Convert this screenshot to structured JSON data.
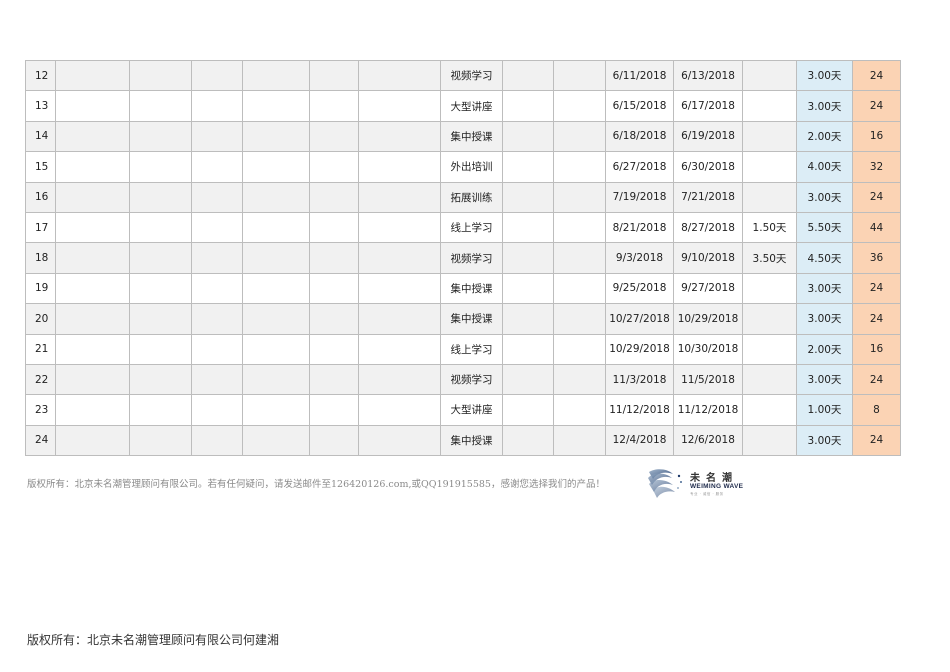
{
  "table": {
    "rows": [
      {
        "no": "12",
        "type": "视频学习",
        "start": "6/11/2018",
        "end": "6/13/2018",
        "extra": "",
        "days": "3.00天",
        "hours": "24"
      },
      {
        "no": "13",
        "type": "大型讲座",
        "start": "6/15/2018",
        "end": "6/17/2018",
        "extra": "",
        "days": "3.00天",
        "hours": "24"
      },
      {
        "no": "14",
        "type": "集中授课",
        "start": "6/18/2018",
        "end": "6/19/2018",
        "extra": "",
        "days": "2.00天",
        "hours": "16"
      },
      {
        "no": "15",
        "type": "外出培训",
        "start": "6/27/2018",
        "end": "6/30/2018",
        "extra": "",
        "days": "4.00天",
        "hours": "32"
      },
      {
        "no": "16",
        "type": "拓展训练",
        "start": "7/19/2018",
        "end": "7/21/2018",
        "extra": "",
        "days": "3.00天",
        "hours": "24"
      },
      {
        "no": "17",
        "type": "线上学习",
        "start": "8/21/2018",
        "end": "8/27/2018",
        "extra": "1.50天",
        "days": "5.50天",
        "hours": "44"
      },
      {
        "no": "18",
        "type": "视频学习",
        "start": "9/3/2018",
        "end": "9/10/2018",
        "extra": "3.50天",
        "days": "4.50天",
        "hours": "36"
      },
      {
        "no": "19",
        "type": "集中授课",
        "start": "9/25/2018",
        "end": "9/27/2018",
        "extra": "",
        "days": "3.00天",
        "hours": "24"
      },
      {
        "no": "20",
        "type": "集中授课",
        "start": "10/27/2018",
        "end": "10/29/2018",
        "extra": "",
        "days": "3.00天",
        "hours": "24"
      },
      {
        "no": "21",
        "type": "线上学习",
        "start": "10/29/2018",
        "end": "10/30/2018",
        "extra": "",
        "days": "2.00天",
        "hours": "16"
      },
      {
        "no": "22",
        "type": "视频学习",
        "start": "11/3/2018",
        "end": "11/5/2018",
        "extra": "",
        "days": "3.00天",
        "hours": "24"
      },
      {
        "no": "23",
        "type": "大型讲座",
        "start": "11/12/2018",
        "end": "11/12/2018",
        "extra": "",
        "days": "1.00天",
        "hours": "8"
      },
      {
        "no": "24",
        "type": "集中授课",
        "start": "12/4/2018",
        "end": "12/6/2018",
        "extra": "",
        "days": "3.00天",
        "hours": "24"
      }
    ]
  },
  "footnote": "版权所有：北京未名潮管理顾问有限公司。若有任何疑问，请发送邮件至126420126.com,或QQ191915585，感谢您选择我们的产品！",
  "logo": {
    "name_cn": "未名潮",
    "name_en": "WEIMING WAVE",
    "tagline": "专业 · 诚信 · 服务",
    "icon": "swirl-wave-logo-icon"
  },
  "copyright": "版权所有：北京未名潮管理顾问有限公司何建湘",
  "colors": {
    "days_fill": "#dcedf6",
    "hours_fill": "#fbd3b4",
    "alt_row_fill": "#f1f1f1",
    "border": "#bdbdbd"
  }
}
